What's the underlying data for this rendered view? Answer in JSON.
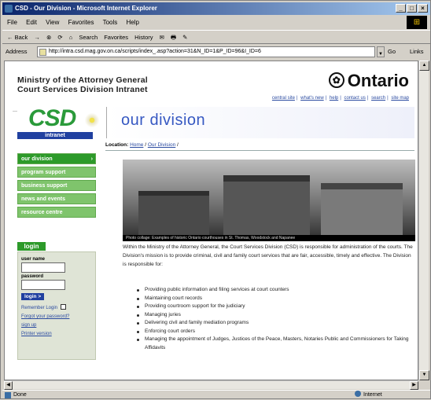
{
  "window": {
    "title": "CSD - Our Division - Microsoft Internet Explorer",
    "controls": [
      "_",
      "□",
      "×"
    ]
  },
  "menu": [
    "File",
    "Edit",
    "View",
    "Favorites",
    "Tools",
    "Help"
  ],
  "toolbar": [
    "← Back",
    "→",
    "⊗",
    "⟳",
    "⌂",
    "Search",
    "Favorites",
    "History",
    "✉",
    "🖶",
    "✎"
  ],
  "address": {
    "label": "Address",
    "url": "http://intra.csd.mag.gov.on.ca/scripts/index_.asp?action=31&N_ID=1&P_ID=96&I_ID=6",
    "go": "Go",
    "links": "Links"
  },
  "status": {
    "left": "Done",
    "zone": "Internet"
  },
  "page": {
    "ministry_line1": "Ministry of the Attorney General",
    "ministry_line2": "Court Services Division Intranet",
    "ontario": "Ontario",
    "top_links": [
      "central site",
      "what's new",
      "help",
      "contact us",
      "search",
      "site map"
    ],
    "logo_main": "CSD",
    "logo_sub": "intranet",
    "section_title": "our division",
    "location_label": "Location:",
    "location_home": "Home",
    "location_current": "Our Division",
    "nav": [
      {
        "label": "our division",
        "active": true
      },
      {
        "label": "program support",
        "active": false
      },
      {
        "label": "business support",
        "active": false
      },
      {
        "label": "news and events",
        "active": false
      },
      {
        "label": "resource centre",
        "active": false
      }
    ],
    "login": {
      "heading": "login",
      "user_label": "user name",
      "password_label": "password",
      "button": "login >",
      "remember": "Remember Login",
      "forgot": "Forgot your password?",
      "signup": "sign up",
      "printer": "Printer version"
    },
    "photo_caption": "Photo collage: Examples of historic Ontario courthouses in St. Thomas, Woodstock and Napanee",
    "intro": "Within the Ministry of the Attorney General, the Court Services Division (CSD) is responsible for administration of the courts. The Division's mission is to provide criminal, civil and family court services that are fair, accessible, timely and effective. The Division is responsible for:",
    "responsibilities": [
      "Providing public information and filing services at court counters",
      "Maintaining court records",
      "Providing courtroom support for the judiciary",
      "Managing juries",
      "Delivering civil and family mediation programs",
      "Enforcing court orders",
      "Managing the appointment of Judges, Justices of the Peace, Masters, Notaries Public and Commissioners for Taking Affidavits"
    ]
  }
}
